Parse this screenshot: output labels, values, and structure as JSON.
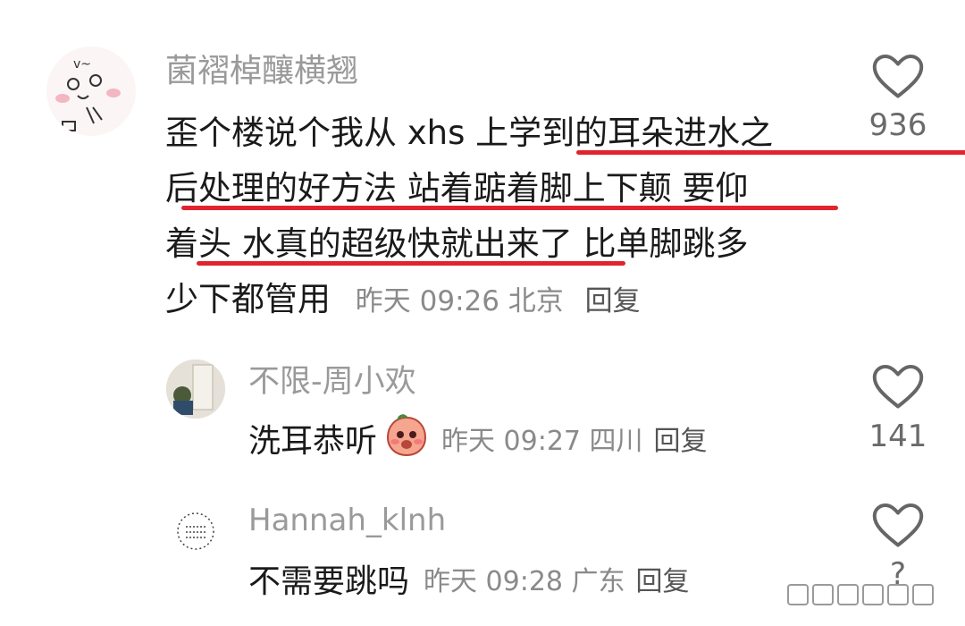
{
  "comments": [
    {
      "username": "菌褶棹釀横翘",
      "text_lines": [
        "歪个楼说个我从 xhs 上学到的耳朵进水之",
        "后处理的好方法 站着踮着脚上下颠 要仰",
        "着头 水真的超级快就出来了 比单脚跳多",
        "少下都管用"
      ],
      "meta": "昨天 09:26 北京",
      "reply_label": "回复",
      "likes": "936"
    },
    {
      "username": "不限-周小欢",
      "text": "洗耳恭听",
      "emoji": "peach-emoji",
      "meta": "昨天 09:27 四川",
      "reply_label": "回复",
      "likes": "141"
    },
    {
      "username": "Hannah_klnh",
      "text": "不需要跳吗",
      "meta": "昨天 09:28 广东",
      "reply_label": "回复",
      "likes": "?"
    }
  ],
  "colors": {
    "underline": "#e0242f",
    "username": "#9a9a9a",
    "meta": "#8a8a8a"
  },
  "icons": [
    "heart-icon",
    "peach-emoji"
  ]
}
